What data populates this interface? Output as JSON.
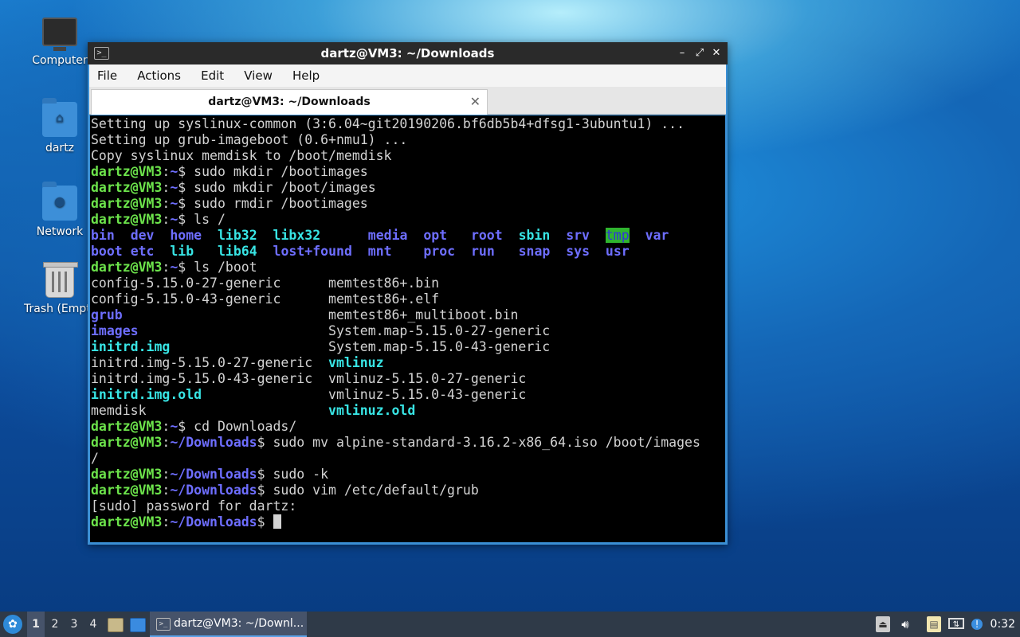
{
  "desktop": {
    "icons": [
      {
        "label": "Computer",
        "icon": "computer-icon"
      },
      {
        "label": "dartz",
        "icon": "home-folder-icon"
      },
      {
        "label": "Network",
        "icon": "network-folder-icon"
      },
      {
        "label": "Trash (Empty)",
        "icon": "trash-icon"
      }
    ]
  },
  "window": {
    "title": "dartz@VM3: ~/Downloads",
    "controls": {
      "minimize": "–",
      "maximize": "⤢",
      "close": "✕"
    },
    "menu": [
      "File",
      "Actions",
      "Edit",
      "View",
      "Help"
    ],
    "tab": {
      "label": "dartz@VM3: ~/Downloads",
      "close": "✕"
    }
  },
  "terminal": {
    "colors": {
      "prompt_user": "#6ce34b",
      "prompt_path": "#6e6eff",
      "dir": "#6e6eff",
      "exec": "#38e5e5",
      "tmp_bg": "#2fb42f",
      "text": "#d3d3d3"
    },
    "lines": [
      [
        {
          "t": "Setting up syslinux-common (3:6.04~git20190206.bf6db5b4+dfsg1-3ubuntu1) ..."
        }
      ],
      [
        {
          "t": "Setting up grub-imageboot (0.6+nmu1) ..."
        }
      ],
      [
        {
          "t": "Copy syslinux memdisk to /boot/memdisk"
        }
      ],
      [
        {
          "t": "dartz@VM3",
          "c": "g"
        },
        {
          "t": ":"
        },
        {
          "t": "~",
          "c": "b"
        },
        {
          "t": "$ sudo mkdir /bootimages"
        }
      ],
      [
        {
          "t": "dartz@VM3",
          "c": "g"
        },
        {
          "t": ":"
        },
        {
          "t": "~",
          "c": "b"
        },
        {
          "t": "$ sudo mkdir /boot/images"
        }
      ],
      [
        {
          "t": "dartz@VM3",
          "c": "g"
        },
        {
          "t": ":"
        },
        {
          "t": "~",
          "c": "b"
        },
        {
          "t": "$ sudo rmdir /bootimages"
        }
      ],
      [
        {
          "t": "dartz@VM3",
          "c": "g"
        },
        {
          "t": ":"
        },
        {
          "t": "~",
          "c": "b"
        },
        {
          "t": "$ ls /"
        }
      ],
      [
        {
          "t": "bin",
          "c": "b"
        },
        {
          "t": "  "
        },
        {
          "t": "dev",
          "c": "b"
        },
        {
          "t": "  "
        },
        {
          "t": "home",
          "c": "b"
        },
        {
          "t": "  "
        },
        {
          "t": "lib32",
          "c": "c"
        },
        {
          "t": "  "
        },
        {
          "t": "libx32",
          "c": "c"
        },
        {
          "t": "      "
        },
        {
          "t": "media",
          "c": "b"
        },
        {
          "t": "  "
        },
        {
          "t": "opt",
          "c": "b"
        },
        {
          "t": "   "
        },
        {
          "t": "root",
          "c": "b"
        },
        {
          "t": "  "
        },
        {
          "t": "sbin",
          "c": "c"
        },
        {
          "t": "  "
        },
        {
          "t": "srv",
          "c": "b"
        },
        {
          "t": "  "
        },
        {
          "t": "tmp",
          "c": "hl"
        },
        {
          "t": "  "
        },
        {
          "t": "var",
          "c": "b"
        }
      ],
      [
        {
          "t": "boot",
          "c": "b"
        },
        {
          "t": " "
        },
        {
          "t": "etc",
          "c": "b"
        },
        {
          "t": "  "
        },
        {
          "t": "lib",
          "c": "c"
        },
        {
          "t": "   "
        },
        {
          "t": "lib64",
          "c": "c"
        },
        {
          "t": "  "
        },
        {
          "t": "lost+found",
          "c": "b"
        },
        {
          "t": "  "
        },
        {
          "t": "mnt",
          "c": "b"
        },
        {
          "t": "    "
        },
        {
          "t": "proc",
          "c": "b"
        },
        {
          "t": "  "
        },
        {
          "t": "run",
          "c": "b"
        },
        {
          "t": "   "
        },
        {
          "t": "snap",
          "c": "b"
        },
        {
          "t": "  "
        },
        {
          "t": "sys",
          "c": "b"
        },
        {
          "t": "  "
        },
        {
          "t": "usr",
          "c": "b"
        }
      ],
      [
        {
          "t": "dartz@VM3",
          "c": "g"
        },
        {
          "t": ":"
        },
        {
          "t": "~",
          "c": "b"
        },
        {
          "t": "$ ls /boot"
        }
      ],
      [
        {
          "t": "config-5.15.0-27-generic      memtest86+.bin"
        }
      ],
      [
        {
          "t": "config-5.15.0-43-generic      memtest86+.elf"
        }
      ],
      [
        {
          "t": "grub",
          "c": "b"
        },
        {
          "t": "                          memtest86+_multiboot.bin"
        }
      ],
      [
        {
          "t": "images",
          "c": "b"
        },
        {
          "t": "                        System.map-5.15.0-27-generic"
        }
      ],
      [
        {
          "t": "initrd.img",
          "c": "c"
        },
        {
          "t": "                    System.map-5.15.0-43-generic"
        }
      ],
      [
        {
          "t": "initrd.img-5.15.0-27-generic  "
        },
        {
          "t": "vmlinuz",
          "c": "c"
        }
      ],
      [
        {
          "t": "initrd.img-5.15.0-43-generic  vmlinuz-5.15.0-27-generic"
        }
      ],
      [
        {
          "t": "initrd.img.old",
          "c": "c"
        },
        {
          "t": "                vmlinuz-5.15.0-43-generic"
        }
      ],
      [
        {
          "t": "memdisk                       "
        },
        {
          "t": "vmlinuz.old",
          "c": "c"
        }
      ],
      [
        {
          "t": "dartz@VM3",
          "c": "g"
        },
        {
          "t": ":"
        },
        {
          "t": "~",
          "c": "b"
        },
        {
          "t": "$ cd Downloads/"
        }
      ],
      [
        {
          "t": "dartz@VM3",
          "c": "g"
        },
        {
          "t": ":"
        },
        {
          "t": "~/Downloads",
          "c": "b"
        },
        {
          "t": "$ sudo mv alpine-standard-3.16.2-x86_64.iso /boot/images"
        }
      ],
      [
        {
          "t": "/"
        }
      ],
      [
        {
          "t": "dartz@VM3",
          "c": "g"
        },
        {
          "t": ":"
        },
        {
          "t": "~/Downloads",
          "c": "b"
        },
        {
          "t": "$ sudo -k"
        }
      ],
      [
        {
          "t": "dartz@VM3",
          "c": "g"
        },
        {
          "t": ":"
        },
        {
          "t": "~/Downloads",
          "c": "b"
        },
        {
          "t": "$ sudo vim /etc/default/grub"
        }
      ],
      [
        {
          "t": "[sudo] password for dartz:"
        }
      ],
      [
        {
          "t": "dartz@VM3",
          "c": "g"
        },
        {
          "t": ":"
        },
        {
          "t": "~/Downloads",
          "c": "b"
        },
        {
          "t": "$ "
        },
        {
          "t": "",
          "c": "cursor"
        }
      ]
    ]
  },
  "taskbar": {
    "start_icon": "start-menu-icon",
    "workspaces": [
      "1",
      "2",
      "3",
      "4"
    ],
    "active_workspace": "1",
    "task": {
      "label": "dartz@VM3: ~/Downl..."
    },
    "tray": [
      "eject-icon",
      "volume-icon",
      "clipboard-icon",
      "network-icon",
      "notification-icon"
    ],
    "clock": "0:32"
  }
}
